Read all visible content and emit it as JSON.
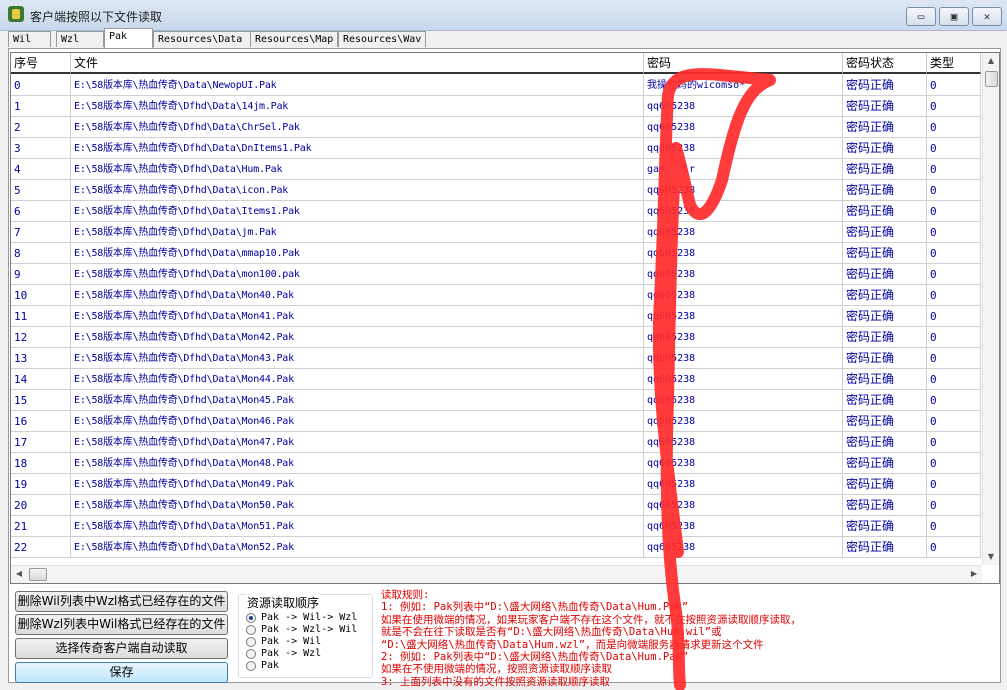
{
  "window": {
    "title": "客户端按照以下文件读取",
    "minimize_glyph": "▭",
    "maximize_glyph": "▣",
    "close_glyph": "✕"
  },
  "tabs": [
    {
      "label": "Wil",
      "active": false
    },
    {
      "label": "Wzl",
      "active": false
    },
    {
      "label": "Pak",
      "active": true
    },
    {
      "label": "Resources\\Data",
      "active": false
    },
    {
      "label": "Resources\\Map",
      "active": false
    },
    {
      "label": "Resources\\Wav",
      "active": false
    }
  ],
  "grid": {
    "headers": {
      "index": "序号",
      "file": "文件",
      "password": "密码",
      "status": "密码状态",
      "type": "类型"
    },
    "rows": [
      {
        "index": "0",
        "file": "E:\\58版本库\\热血传奇\\Data\\NewopUI.Pak",
        "password": "我操你妈的wicomso*",
        "status": "密码正确",
        "type": "0"
      },
      {
        "index": "1",
        "file": "E:\\58版本库\\热血传奇\\Dfhd\\Data\\14jm.Pak",
        "password": "qq605238",
        "status": "密码正确",
        "type": "0"
      },
      {
        "index": "2",
        "file": "E:\\58版本库\\热血传奇\\Dfhd\\Data\\ChrSel.Pak",
        "password": "qq605238",
        "status": "密码正确",
        "type": "0"
      },
      {
        "index": "3",
        "file": "E:\\58版本库\\热血传奇\\Dfhd\\Data\\DnItems1.Pak",
        "password": "qq605238",
        "status": "密码正确",
        "type": "0"
      },
      {
        "index": "4",
        "file": "E:\\58版本库\\热血传奇\\Dfhd\\Data\\Hum.Pak",
        "password": "gam...ir",
        "status": "密码正确",
        "type": "0"
      },
      {
        "index": "5",
        "file": "E:\\58版本库\\热血传奇\\Dfhd\\Data\\icon.Pak",
        "password": "qq605238",
        "status": "密码正确",
        "type": "0"
      },
      {
        "index": "6",
        "file": "E:\\58版本库\\热血传奇\\Dfhd\\Data\\Items1.Pak",
        "password": "qq605238",
        "status": "密码正确",
        "type": "0"
      },
      {
        "index": "7",
        "file": "E:\\58版本库\\热血传奇\\Dfhd\\Data\\jm.Pak",
        "password": "qq605238",
        "status": "密码正确",
        "type": "0"
      },
      {
        "index": "8",
        "file": "E:\\58版本库\\热血传奇\\Dfhd\\Data\\mmap10.Pak",
        "password": "qq605238",
        "status": "密码正确",
        "type": "0"
      },
      {
        "index": "9",
        "file": "E:\\58版本库\\热血传奇\\Dfhd\\Data\\mon100.pak",
        "password": "qq605238",
        "status": "密码正确",
        "type": "0"
      },
      {
        "index": "10",
        "file": "E:\\58版本库\\热血传奇\\Dfhd\\Data\\Mon40.Pak",
        "password": "qq605238",
        "status": "密码正确",
        "type": "0"
      },
      {
        "index": "11",
        "file": "E:\\58版本库\\热血传奇\\Dfhd\\Data\\Mon41.Pak",
        "password": "qq605238",
        "status": "密码正确",
        "type": "0"
      },
      {
        "index": "12",
        "file": "E:\\58版本库\\热血传奇\\Dfhd\\Data\\Mon42.Pak",
        "password": "qq605238",
        "status": "密码正确",
        "type": "0"
      },
      {
        "index": "13",
        "file": "E:\\58版本库\\热血传奇\\Dfhd\\Data\\Mon43.Pak",
        "password": "qq605238",
        "status": "密码正确",
        "type": "0"
      },
      {
        "index": "14",
        "file": "E:\\58版本库\\热血传奇\\Dfhd\\Data\\Mon44.Pak",
        "password": "qq605238",
        "status": "密码正确",
        "type": "0"
      },
      {
        "index": "15",
        "file": "E:\\58版本库\\热血传奇\\Dfhd\\Data\\Mon45.Pak",
        "password": "qq605238",
        "status": "密码正确",
        "type": "0"
      },
      {
        "index": "16",
        "file": "E:\\58版本库\\热血传奇\\Dfhd\\Data\\Mon46.Pak",
        "password": "qq605238",
        "status": "密码正确",
        "type": "0"
      },
      {
        "index": "17",
        "file": "E:\\58版本库\\热血传奇\\Dfhd\\Data\\Mon47.Pak",
        "password": "qq605238",
        "status": "密码正确",
        "type": "0"
      },
      {
        "index": "18",
        "file": "E:\\58版本库\\热血传奇\\Dfhd\\Data\\Mon48.Pak",
        "password": "qq605238",
        "status": "密码正确",
        "type": "0"
      },
      {
        "index": "19",
        "file": "E:\\58版本库\\热血传奇\\Dfhd\\Data\\Mon49.Pak",
        "password": "qq605238",
        "status": "密码正确",
        "type": "0"
      },
      {
        "index": "20",
        "file": "E:\\58版本库\\热血传奇\\Dfhd\\Data\\Mon50.Pak",
        "password": "qq605238",
        "status": "密码正确",
        "type": "0"
      },
      {
        "index": "21",
        "file": "E:\\58版本库\\热血传奇\\Dfhd\\Data\\Mon51.Pak",
        "password": "qq605238",
        "status": "密码正确",
        "type": "0"
      },
      {
        "index": "22",
        "file": "E:\\58版本库\\热血传奇\\Dfhd\\Data\\Mon52.Pak",
        "password": "qq605238",
        "status": "密码正确",
        "type": "0"
      }
    ]
  },
  "buttons": {
    "delete_wil": "删除Wil列表中Wzl格式已经存在的文件",
    "delete_wzl": "删除Wzl列表中Wil格式已经存在的文件",
    "auto_read": "选择传奇客户端自动读取",
    "save": "保存"
  },
  "read_order": {
    "title": "资源读取顺序",
    "options": [
      {
        "label": "Pak -> Wil-> Wzl",
        "checked": true
      },
      {
        "label": "Pak -> Wzl-> Wil",
        "checked": false
      },
      {
        "label": "Pak -> Wil",
        "checked": false
      },
      {
        "label": "Pak -> Wzl",
        "checked": false
      },
      {
        "label": "Pak",
        "checked": false
      }
    ]
  },
  "rules": [
    "读取规则:",
    "1: 例如: Pak列表中“D:\\盛大网络\\热血传奇\\Data\\Hum.Pak”",
    "   如果在使用微端的情况，如果玩家客户端不存在这个文件，就不在按照资源读取顺序读取，",
    "   就是不会在往下读取是否有“D:\\盛大网络\\热血传奇\\Data\\Hum.wil”或",
    "“D:\\盛大网络\\热血传奇\\Data\\Hum.wzl”，而是向微端服务器请求更新这个文件",
    "2: 例如: Pak列表中“D:\\盛大网络\\热血传奇\\Data\\Hum.Pak”",
    "   如果在不使用微端的情况，按照资源读取顺序读取",
    "3: 上面列表中没有的文件按照资源读取顺序读取"
  ],
  "colors": {
    "row_text": "#0000a0",
    "rule_text": "#e00000",
    "scribble": "#ff2a2a"
  }
}
